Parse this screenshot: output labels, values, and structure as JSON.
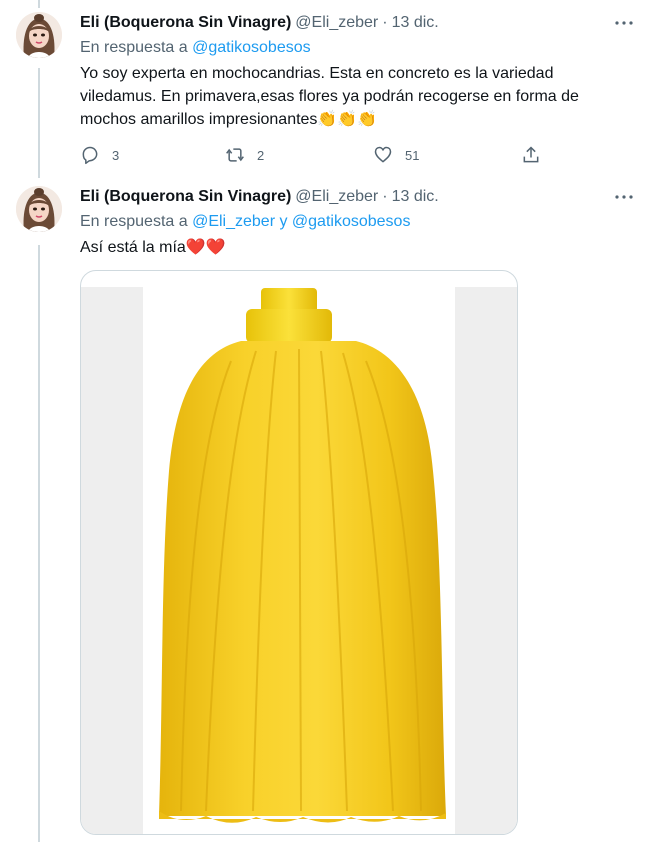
{
  "colors": {
    "accent": "#1d9bf0",
    "text": "#0f1419",
    "muted": "#536471",
    "line": "#cfd9de",
    "mop": "#f4c715"
  },
  "tweets": [
    {
      "name": "Eli (Boquerona Sin Vinagre)",
      "handle": "@Eli_zeber",
      "sep": "·",
      "time": "13 dic.",
      "reply_prefix": "En respuesta a ",
      "reply_mentions": "@gatikosobesos",
      "text_line1": "Yo soy experta en mochocandrias. Esta en concreto es la variedad",
      "text_line2": "viledamus. En primavera,esas flores ya podrán recogerse en forma de",
      "text_line3": "mochos amarillos impresionantes👏👏👏",
      "actions": {
        "replies": "3",
        "retweets": "2",
        "likes": "51"
      }
    },
    {
      "name": "Eli (Boquerona Sin Vinagre)",
      "handle": "@Eli_zeber",
      "sep": "·",
      "time": "13 dic.",
      "reply_prefix": "En respuesta a ",
      "reply_mentions": "@Eli_zeber y @gatikosobesos",
      "text": "Así está la mía",
      "hearts": "❤️❤️",
      "media_icon": "yellow-mop-head-image"
    }
  ]
}
